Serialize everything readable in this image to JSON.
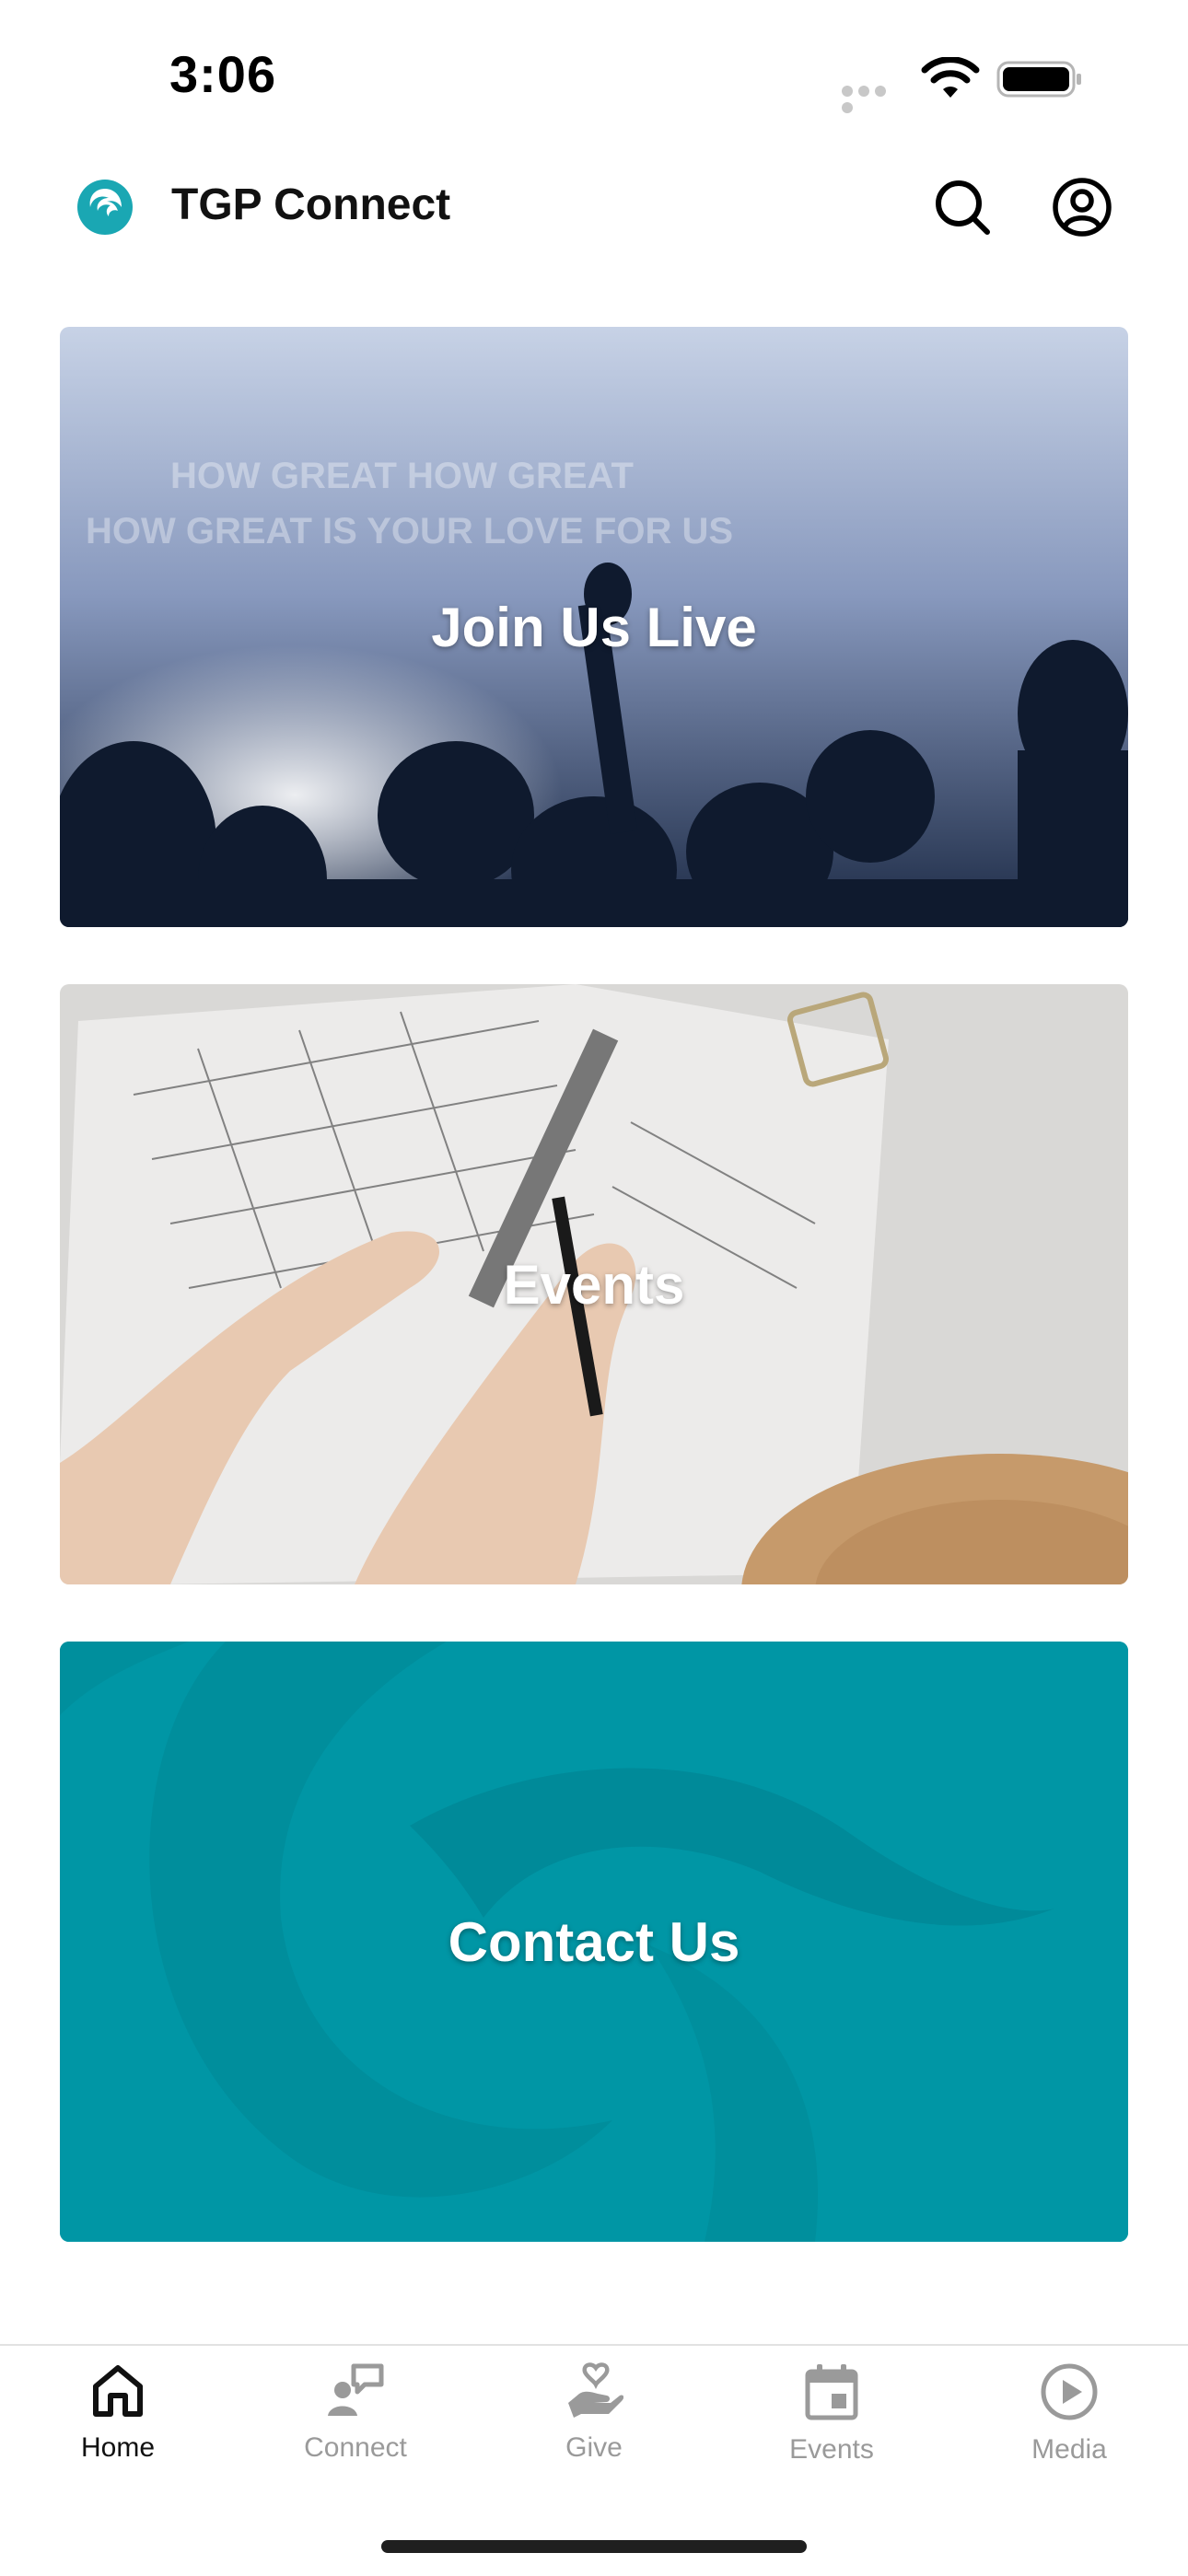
{
  "status_bar": {
    "time": "3:06"
  },
  "header": {
    "title": "TGP Connect"
  },
  "cards": [
    {
      "label": "Join Us Live",
      "image_text_line1": "HOW GREAT HOW GREAT",
      "image_text_line2": "HOW GREAT IS YOUR LOVE FOR US"
    },
    {
      "label": "Events"
    },
    {
      "label": "Contact Us"
    }
  ],
  "tabs": [
    {
      "label": "Home",
      "icon": "home-icon",
      "active": true
    },
    {
      "label": "Connect",
      "icon": "connect-icon",
      "active": false
    },
    {
      "label": "Give",
      "icon": "give-icon",
      "active": false
    },
    {
      "label": "Events",
      "icon": "calendar-icon",
      "active": false
    },
    {
      "label": "Media",
      "icon": "play-icon",
      "active": false
    }
  ],
  "colors": {
    "accent": "#0096A5",
    "active_tab": "#111111",
    "inactive_tab": "#9A9A9A"
  }
}
